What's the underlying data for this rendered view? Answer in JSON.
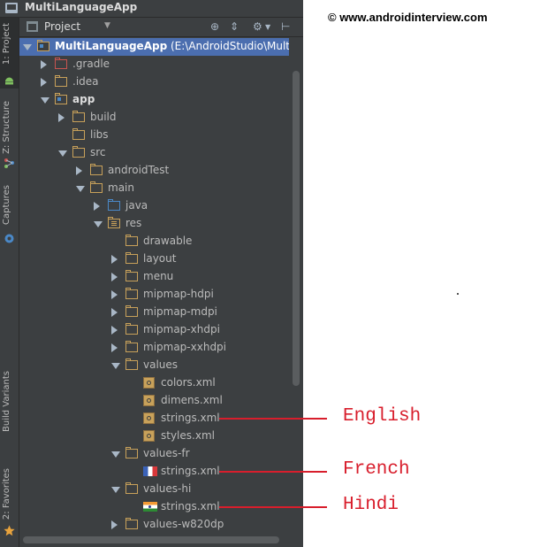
{
  "window": {
    "title": "MultiLanguageApp"
  },
  "toolwindow_bar": {
    "tabs": [
      {
        "label": "1: Project",
        "active": true
      },
      {
        "label": "Z: Structure",
        "active": false
      },
      {
        "label": "Captures",
        "active": false
      },
      {
        "label": "Build Variants",
        "active": false
      },
      {
        "label": "2: Favorites",
        "active": false
      }
    ]
  },
  "project_panel": {
    "view_selector": "Project",
    "tree": [
      {
        "label": "MultiLanguageApp",
        "suffix": " (E:\\AndroidStudio\\MultiLang",
        "icon": "module-folder-icon",
        "depth": 0,
        "expanded": true,
        "selected": true
      },
      {
        "label": ".gradle",
        "icon": "excluded-folder-icon",
        "depth": 1,
        "expanded": false
      },
      {
        "label": ".idea",
        "icon": "folder-icon",
        "depth": 1,
        "expanded": false
      },
      {
        "label": "app",
        "icon": "module-folder-icon",
        "depth": 1,
        "expanded": true,
        "bold": true
      },
      {
        "label": "build",
        "icon": "folder-icon",
        "depth": 2,
        "expanded": false
      },
      {
        "label": "libs",
        "icon": "folder-icon",
        "depth": 2,
        "leaf": true
      },
      {
        "label": "src",
        "icon": "folder-icon",
        "depth": 2,
        "expanded": true
      },
      {
        "label": "androidTest",
        "icon": "folder-icon",
        "depth": 3,
        "expanded": false
      },
      {
        "label": "main",
        "icon": "folder-icon",
        "depth": 3,
        "expanded": true
      },
      {
        "label": "java",
        "icon": "source-folder-icon",
        "depth": 4,
        "expanded": false
      },
      {
        "label": "res",
        "icon": "resource-folder-icon",
        "depth": 4,
        "expanded": true
      },
      {
        "label": "drawable",
        "icon": "folder-icon",
        "depth": 5,
        "leaf": true
      },
      {
        "label": "layout",
        "icon": "folder-icon",
        "depth": 5,
        "expanded": false
      },
      {
        "label": "menu",
        "icon": "folder-icon",
        "depth": 5,
        "expanded": false
      },
      {
        "label": "mipmap-hdpi",
        "icon": "folder-icon",
        "depth": 5,
        "expanded": false
      },
      {
        "label": "mipmap-mdpi",
        "icon": "folder-icon",
        "depth": 5,
        "expanded": false
      },
      {
        "label": "mipmap-xhdpi",
        "icon": "folder-icon",
        "depth": 5,
        "expanded": false
      },
      {
        "label": "mipmap-xxhdpi",
        "icon": "folder-icon",
        "depth": 5,
        "expanded": false
      },
      {
        "label": "values",
        "icon": "folder-icon",
        "depth": 5,
        "expanded": true
      },
      {
        "label": "colors.xml",
        "icon": "xml-file-icon",
        "depth": 6,
        "leaf": true
      },
      {
        "label": "dimens.xml",
        "icon": "xml-file-icon",
        "depth": 6,
        "leaf": true
      },
      {
        "label": "strings.xml",
        "icon": "xml-file-icon",
        "depth": 6,
        "leaf": true
      },
      {
        "label": "styles.xml",
        "icon": "xml-file-icon",
        "depth": 6,
        "leaf": true
      },
      {
        "label": "values-fr",
        "icon": "folder-icon",
        "depth": 5,
        "expanded": true
      },
      {
        "label": "strings.xml",
        "icon": "french-flag-icon",
        "depth": 6,
        "leaf": true
      },
      {
        "label": "values-hi",
        "icon": "folder-icon",
        "depth": 5,
        "expanded": true
      },
      {
        "label": "strings.xml",
        "icon": "indian-flag-icon",
        "depth": 6,
        "leaf": true
      },
      {
        "label": "values-w820dp",
        "icon": "folder-icon",
        "depth": 5,
        "expanded": false
      }
    ]
  },
  "watermark": "© www.androidinterview.com",
  "annotations": [
    {
      "label": "English",
      "row_index": 21
    },
    {
      "label": "French",
      "row_index": 24
    },
    {
      "label": "Hindi",
      "row_index": 26
    }
  ],
  "colors": {
    "ide_background": "#3c3f41",
    "selection": "#4b6eaf",
    "annotation": "#d81e2c",
    "folder": "#c8a15a"
  }
}
